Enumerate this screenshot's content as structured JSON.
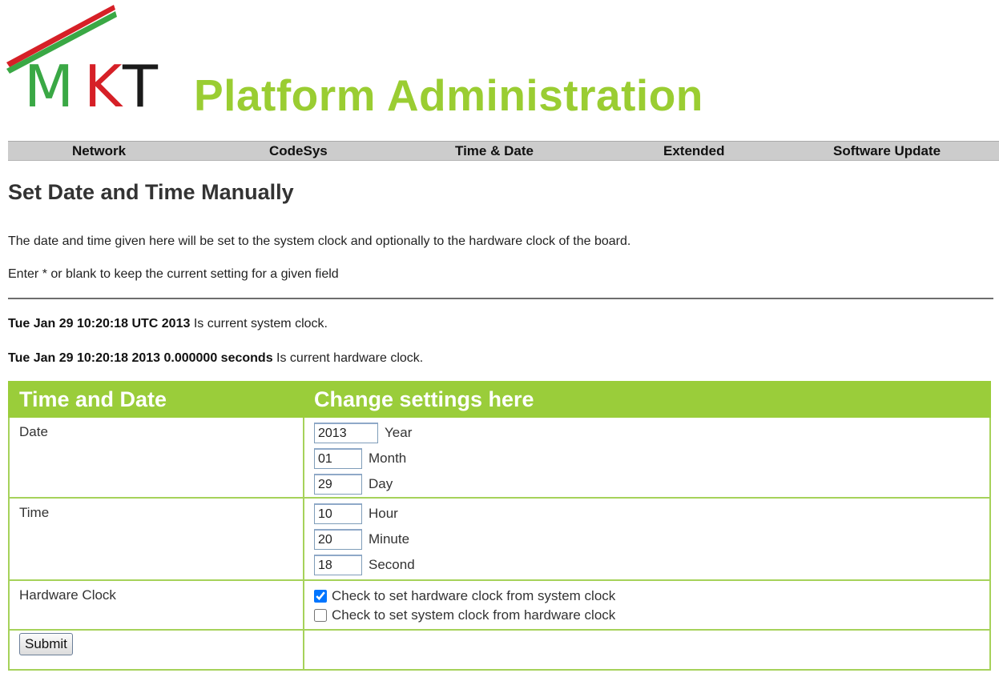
{
  "header": {
    "logo": {
      "letters": [
        "M",
        "K",
        "T"
      ],
      "colors": [
        "#3aa845",
        "#d62027",
        "#1a1a1a"
      ]
    },
    "title": "Platform Administration",
    "title_color": "#9acd32"
  },
  "nav": {
    "items": [
      {
        "label": "Network"
      },
      {
        "label": "CodeSys"
      },
      {
        "label": "Time & Date"
      },
      {
        "label": "Extended"
      },
      {
        "label": "Software Update"
      }
    ]
  },
  "main": {
    "title": "Set Date and Time Manually",
    "intro": [
      "The date and time given here will be set to the system clock and optionally to the hardware clock of the board.",
      "Enter * or blank to keep the current setting for a given field"
    ],
    "system_clock": {
      "value": "Tue Jan 29 10:20:18 UTC 2013",
      "suffix": " Is current system clock."
    },
    "hardware_clock": {
      "value": "Tue Jan 29 10:20:18 2013 0.000000 seconds",
      "suffix": " Is current hardware clock."
    }
  },
  "table": {
    "headers": [
      "Time and Date",
      "Change settings here"
    ],
    "accent": "#9acd3a",
    "date": {
      "label": "Date",
      "fields": [
        {
          "value": "2013",
          "label": "Year"
        },
        {
          "value": "01",
          "label": "Month"
        },
        {
          "value": "29",
          "label": "Day"
        }
      ]
    },
    "time": {
      "label": "Time",
      "fields": [
        {
          "value": "10",
          "label": "Hour"
        },
        {
          "value": "20",
          "label": "Minute"
        },
        {
          "value": "18",
          "label": "Second"
        }
      ]
    },
    "hardware_clock": {
      "label": "Hardware Clock",
      "options": [
        {
          "label": "Check to set hardware clock from system clock",
          "checked": true
        },
        {
          "label": "Check to set system clock from hardware clock",
          "checked": false
        }
      ]
    },
    "submit_label": "Submit"
  }
}
